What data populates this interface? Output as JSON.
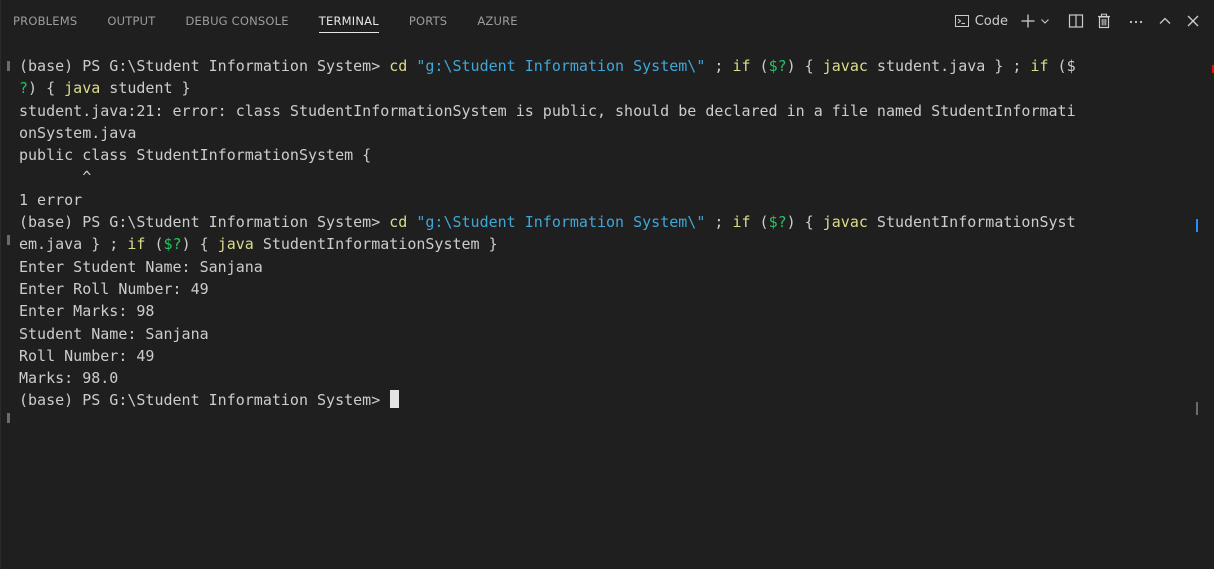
{
  "tabs": [
    {
      "label": "PROBLEMS",
      "active": false
    },
    {
      "label": "OUTPUT",
      "active": false
    },
    {
      "label": "DEBUG CONSOLE",
      "active": false
    },
    {
      "label": "TERMINAL",
      "active": true
    },
    {
      "label": "PORTS",
      "active": false
    },
    {
      "label": "AZURE",
      "active": false
    }
  ],
  "actions": {
    "profile_label": "Code",
    "icons": [
      "terminal-icon",
      "plus-icon",
      "chevron-down-icon",
      "split-icon",
      "trash-icon",
      "ellipsis-icon",
      "chevron-up-icon",
      "close-icon"
    ]
  },
  "terminal": {
    "l1": {
      "prompt": "(base) PS G:\\Student Information System> ",
      "cmd": "cd",
      "sp1": " ",
      "path": "\"g:\\Student Information System\\\"",
      "sep1": " ; ",
      "if1": "if",
      "cond1": " (",
      "var1": "$?",
      "close1": ") { ",
      "javac": "javac",
      "arg1": " student.java } ; ",
      "if2": "if",
      "cond2": " ($"
    },
    "l2": {
      "var2": "?",
      "close2": ") { ",
      "java": "java",
      "arg2": " student }"
    },
    "l3": "student.java:21: error: class StudentInformationSystem is public, should be declared in a file named StudentInformati",
    "l4": "onSystem.java",
    "l5": "public class StudentInformationSystem {",
    "l6": "       ^",
    "l7": "1 error",
    "l8": {
      "prompt": "(base) PS G:\\Student Information System> ",
      "cmd": "cd",
      "sp1": " ",
      "path": "\"g:\\Student Information System\\\"",
      "sep1": " ; ",
      "if1": "if",
      "cond1": " (",
      "var1": "$?",
      "close1": ") { ",
      "javac": "javac",
      "arg1": " StudentInformationSyst"
    },
    "l9": {
      "cont": "em.java } ; ",
      "if2": "if",
      "cond2": " (",
      "var2": "$?",
      "close2": ") { ",
      "java": "java",
      "arg2": " StudentInformationSystem }"
    },
    "l10": "Enter Student Name: Sanjana",
    "l11": "Enter Roll Number: 49",
    "l12": "Enter Marks: 98",
    "l13": "Student Name: Sanjana",
    "l14": "Roll Number: 49",
    "l15": "Marks: 98.0",
    "l16": "(base) PS G:\\Student Information System> "
  },
  "colors": {
    "background": "#1f1f1f",
    "command": "#dcdc8b",
    "string": "#3fa7d6",
    "keyword": "#c586c0",
    "variable": "#22c35e",
    "text": "#cccccc",
    "error_marker": "#e51400",
    "scroll_marker_blue": "#1e90ff"
  }
}
